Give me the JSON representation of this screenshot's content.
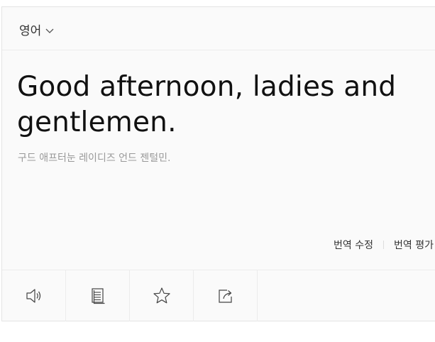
{
  "language_selector": {
    "label": "영어",
    "icon": "chevron-down-icon"
  },
  "translation": {
    "text": "Good afternoon, ladies and gentlemen.",
    "pronunciation": "구드 애프터눈 레이디즈 언드 젠털민."
  },
  "actions": {
    "edit_label": "번역 수정",
    "rate_label": "번역 평가"
  },
  "toolbar": {
    "buttons": [
      {
        "icon": "speaker-icon"
      },
      {
        "icon": "document-icon"
      },
      {
        "icon": "star-icon"
      },
      {
        "icon": "share-icon"
      }
    ]
  }
}
